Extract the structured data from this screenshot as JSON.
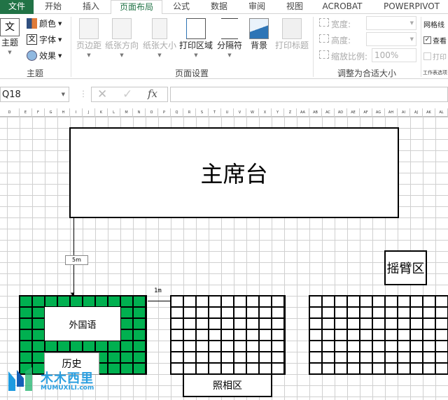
{
  "tabs": [
    "文件",
    "开始",
    "插入",
    "页面布局",
    "公式",
    "数据",
    "审阅",
    "视图",
    "ACROBAT",
    "POWERPIVOT"
  ],
  "active_tab": "页面布局",
  "ribbon": {
    "theme_group": {
      "label": "主题",
      "theme_button": "主题",
      "colors": "颜色",
      "fonts": "字体",
      "effects": "效果"
    },
    "page_setup": {
      "label": "页面设置",
      "margins": "页边距",
      "orientation": "纸张方向",
      "size": "纸张大小",
      "print_area": "打印区域",
      "breaks": "分隔符",
      "background": "背景",
      "print_titles": "打印标题"
    },
    "scale_to_fit": {
      "label": "调整为合适大小",
      "width_label": "宽度:",
      "height_label": "高度:",
      "scale_label": "缩放比例:",
      "scale_value": "100%"
    },
    "sheet_options": {
      "gridlines_label": "网格线",
      "view": "查看",
      "print": "打印",
      "group_label": "工作表选项"
    }
  },
  "formula_bar": {
    "name_box": "Q18",
    "fx": "fx",
    "formula": ""
  },
  "columns": [
    "D",
    "E",
    "F",
    "G",
    "H",
    "I",
    "J",
    "K",
    "L",
    "M",
    "N",
    "O",
    "P",
    "Q",
    "R",
    "S",
    "T",
    "U",
    "V",
    "W",
    "X",
    "Y",
    "Z",
    "AA",
    "AB",
    "AC",
    "AD",
    "AE",
    "AF",
    "AG",
    "AH",
    "AI",
    "AJ",
    "AK",
    "AL"
  ],
  "diagram": {
    "stage": "主席台",
    "dist_vertical": "5m",
    "dist_horizontal": "1m",
    "foreign_lang": "外国语",
    "history": "历史",
    "photo_area": "照相区",
    "crane_area": "摇臂区"
  },
  "watermark": {
    "name": "木木西里",
    "url": "MUMUXILI.com"
  },
  "colors": {
    "excel_green": "#217346",
    "block_green": "#00b050"
  }
}
